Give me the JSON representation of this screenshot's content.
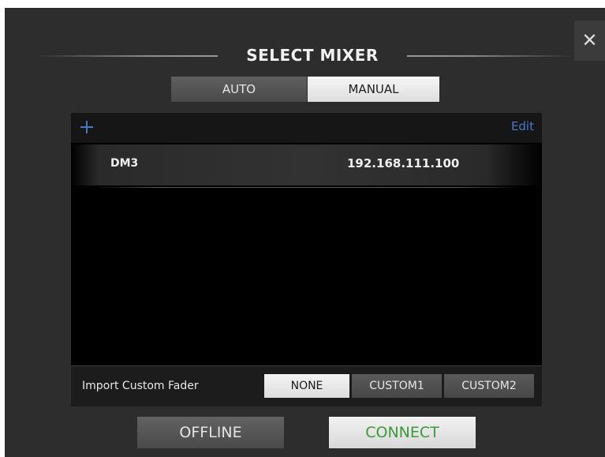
{
  "dialog": {
    "title": "SELECT MIXER",
    "close_icon": "close-icon",
    "close_glyph": "✕"
  },
  "mode_tabs": {
    "auto_label": "AUTO",
    "manual_label": "MANUAL",
    "selected": "MANUAL"
  },
  "list": {
    "add_icon": "plus-icon",
    "edit_label": "Edit",
    "rows": [
      {
        "name": "DM3",
        "ip": "192.168.111.100"
      }
    ]
  },
  "import_fader": {
    "label": "Import Custom Fader",
    "options": [
      "NONE",
      "CUSTOM1",
      "CUSTOM2"
    ],
    "selected": "NONE"
  },
  "actions": {
    "offline_label": "OFFLINE",
    "connect_label": "CONNECT"
  },
  "colors": {
    "dialog_bg": "#2d2d2d",
    "accent_blue": "#4a78c8",
    "connect_green": "#3c9a3c"
  }
}
